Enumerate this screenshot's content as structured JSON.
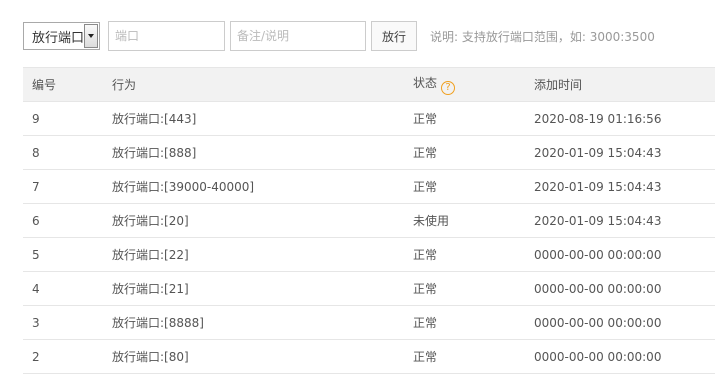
{
  "toolbar": {
    "select_value": "放行端口",
    "port_placeholder": "端口",
    "note_placeholder": "备注/说明",
    "submit_label": "放行",
    "hint": "说明: 支持放行端口范围，如: 3000:3500"
  },
  "table": {
    "headers": {
      "id": "编号",
      "action": "行为",
      "status": "状态",
      "time": "添加时间"
    },
    "status_help_icon": "?",
    "rows": [
      {
        "id": "9",
        "action": "放行端口:[443]",
        "status": "正常",
        "time": "2020-08-19 01:16:56"
      },
      {
        "id": "8",
        "action": "放行端口:[888]",
        "status": "正常",
        "time": "2020-01-09 15:04:43"
      },
      {
        "id": "7",
        "action": "放行端口:[39000-40000]",
        "status": "正常",
        "time": "2020-01-09 15:04:43"
      },
      {
        "id": "6",
        "action": "放行端口:[20]",
        "status": "未使用",
        "time": "2020-01-09 15:04:43"
      },
      {
        "id": "5",
        "action": "放行端口:[22]",
        "status": "正常",
        "time": "0000-00-00 00:00:00"
      },
      {
        "id": "4",
        "action": "放行端口:[21]",
        "status": "正常",
        "time": "0000-00-00 00:00:00"
      },
      {
        "id": "3",
        "action": "放行端口:[8888]",
        "status": "正常",
        "time": "0000-00-00 00:00:00"
      },
      {
        "id": "2",
        "action": "放行端口:[80]",
        "status": "正常",
        "time": "0000-00-00 00:00:00"
      }
    ]
  },
  "colors": {
    "header_bg": "#f2f2f2",
    "border": "#e6e6e6",
    "help_icon": "#f0a020",
    "hint_text": "#999999"
  }
}
